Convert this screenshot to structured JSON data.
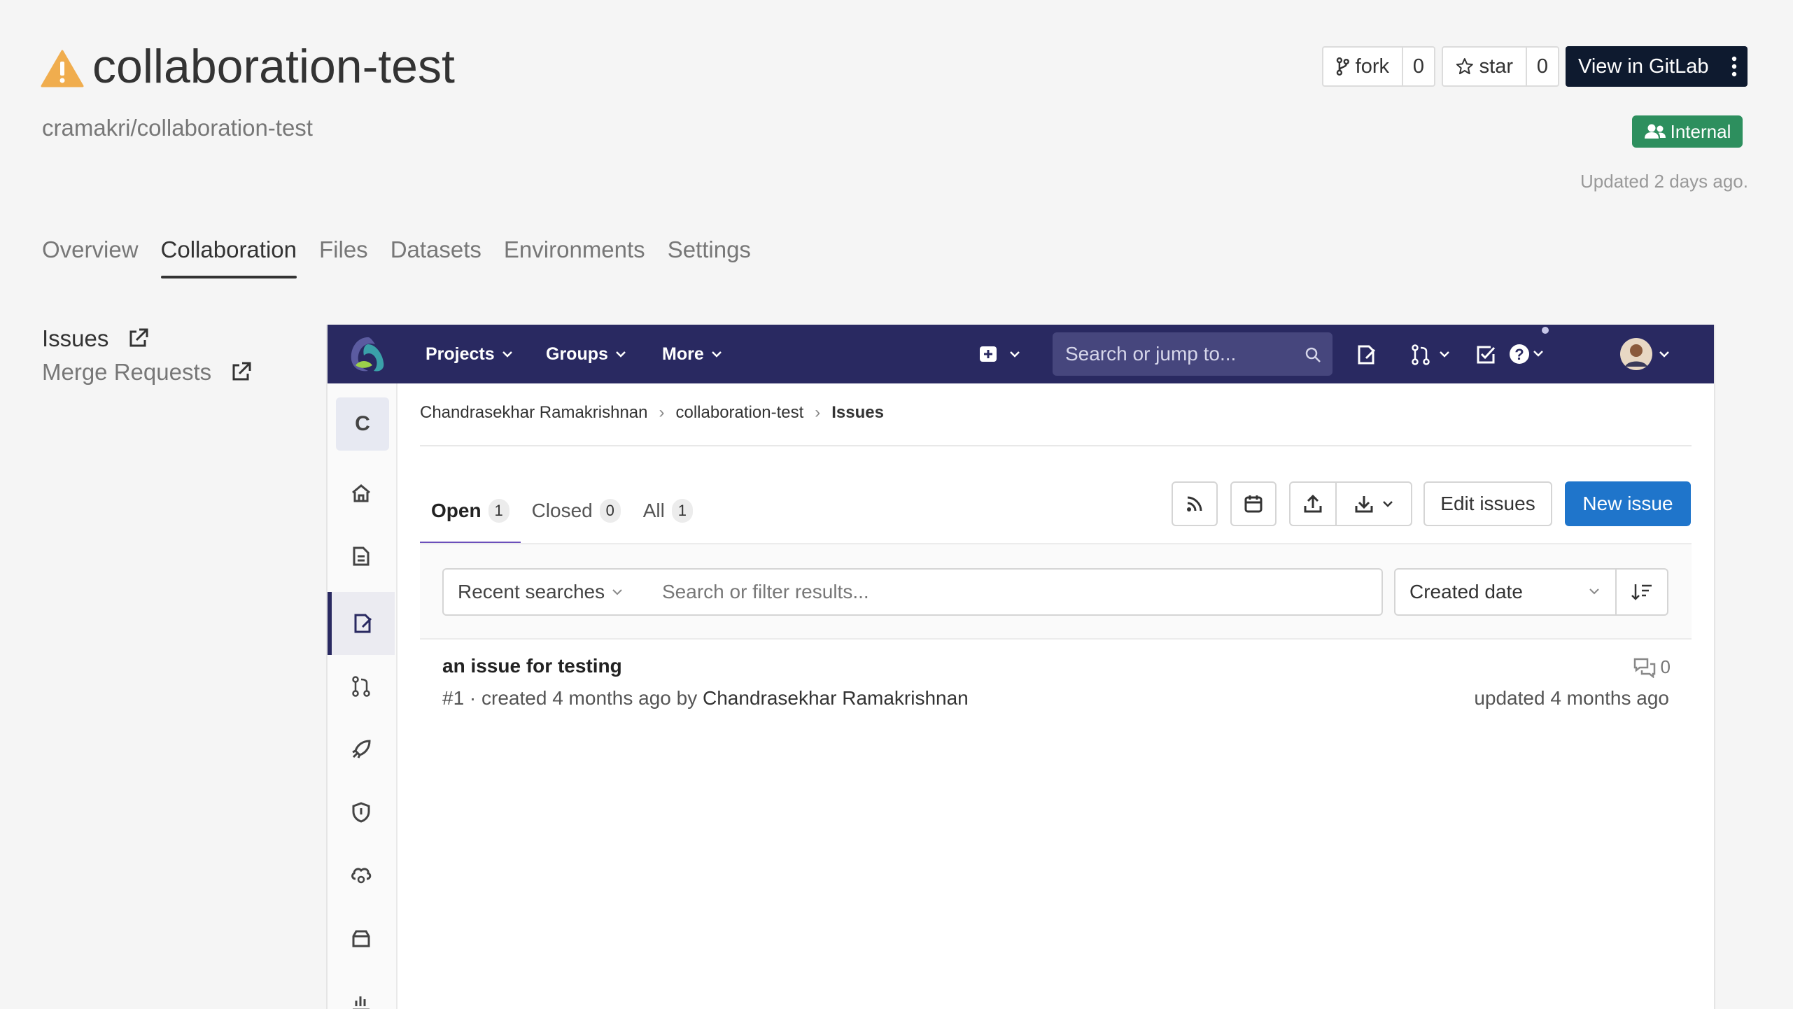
{
  "project": {
    "title": "collaboration-test",
    "path": "cramakri/collaboration-test",
    "visibility": "Internal",
    "updated": "Updated 2 days ago."
  },
  "actions": {
    "fork_label": "fork",
    "fork_count": "0",
    "star_label": "star",
    "star_count": "0",
    "gitlab_label": "View in GitLab"
  },
  "tabs": [
    {
      "label": "Overview"
    },
    {
      "label": "Collaboration",
      "active": true
    },
    {
      "label": "Files"
    },
    {
      "label": "Datasets"
    },
    {
      "label": "Environments"
    },
    {
      "label": "Settings"
    }
  ],
  "collab_menu": {
    "issues": "Issues",
    "merge_requests": "Merge Requests"
  },
  "gitlab": {
    "nav": {
      "projects": "Projects",
      "groups": "Groups",
      "more": "More",
      "search_placeholder": "Search or jump to..."
    },
    "rail_avatar": "C",
    "breadcrumb": [
      "Chandrasekhar Ramakrishnan",
      "collaboration-test",
      "Issues"
    ],
    "issue_tabs": [
      {
        "label": "Open",
        "count": "1"
      },
      {
        "label": "Closed",
        "count": "0"
      },
      {
        "label": "All",
        "count": "1"
      }
    ],
    "buttons": {
      "edit": "Edit issues",
      "new": "New issue"
    },
    "filter": {
      "recent": "Recent searches",
      "placeholder": "Search or filter results...",
      "sort": "Created date"
    },
    "issue": {
      "title": "an issue for testing",
      "meta": "#1 · created 4 months ago by ",
      "author": "Chandrasekhar Ramakrishnan",
      "comments": "0",
      "updated": "updated 4 months ago"
    }
  },
  "colors": {
    "gitlab_nav": "#292961",
    "primary_button": "#1f75cb",
    "internal_badge": "#2d8f5e",
    "warning": "#f0ad4e"
  }
}
